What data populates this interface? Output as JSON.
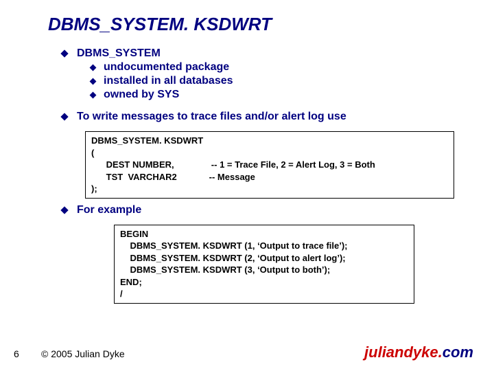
{
  "title": "DBMS_SYSTEM. KSDWRT",
  "bullets": {
    "b0": "DBMS_SYSTEM",
    "b0_children": {
      "c0": "undocumented package",
      "c1": "installed in all databases",
      "c2": "owned by SYS"
    },
    "b1": "To write messages to trace files and/or alert log use",
    "b2": "For example"
  },
  "code1": "DBMS_SYSTEM. KSDWRT\n(\n      DEST NUMBER,               -- 1 = Trace File, 2 = Alert Log, 3 = Both\n      TST  VARCHAR2             -- Message\n);",
  "code2": "BEGIN\n    DBMS_SYSTEM. KSDWRT (1, ‘Output to trace file’);\n    DBMS_SYSTEM. KSDWRT (2, ‘Output to alert log’);\n    DBMS_SYSTEM. KSDWRT (3, ‘Output to both’);\nEND;\n/",
  "footer": {
    "page": "6",
    "copyright": "© 2005 Julian Dyke",
    "brand_a": "juliandyke.",
    "brand_b": "com"
  }
}
